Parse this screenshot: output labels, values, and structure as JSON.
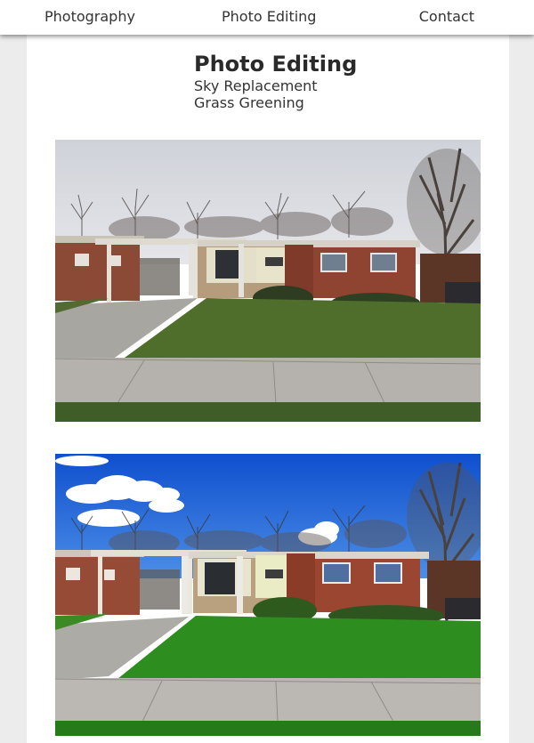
{
  "nav": {
    "items": [
      {
        "label": "Photography"
      },
      {
        "label": "Photo Editing"
      },
      {
        "label": "Contact"
      }
    ]
  },
  "page": {
    "title": "Photo Editing",
    "subtitles": [
      "Sky Replacement",
      "Grass Greening"
    ]
  },
  "photos": {
    "before": {
      "sky_color": "#dcdde2",
      "grass_color": "#4f6e2c"
    },
    "after": {
      "sky_color": "#1e63d6",
      "grass_color": "#2e8d1f"
    }
  }
}
